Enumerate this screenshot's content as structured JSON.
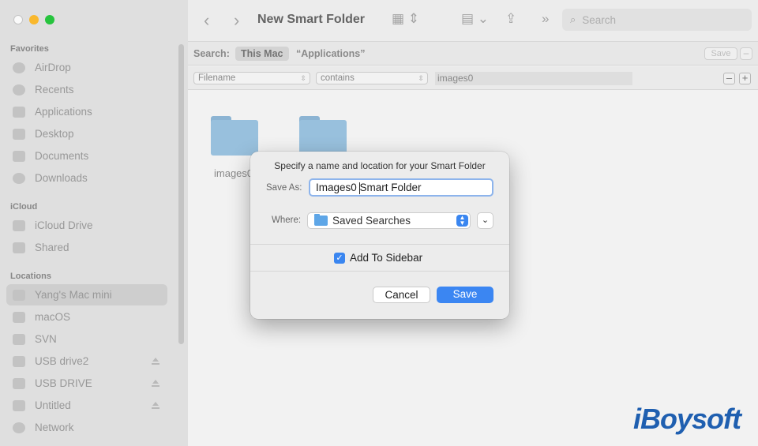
{
  "window": {
    "title": "New Smart Folder"
  },
  "sidebar": {
    "favorites_header": "Favorites",
    "favorites": [
      {
        "label": "AirDrop",
        "icon": "airdrop-icon"
      },
      {
        "label": "Recents",
        "icon": "clock-icon"
      },
      {
        "label": "Applications",
        "icon": "applications-icon"
      },
      {
        "label": "Desktop",
        "icon": "desktop-icon"
      },
      {
        "label": "Documents",
        "icon": "document-icon"
      },
      {
        "label": "Downloads",
        "icon": "download-icon"
      }
    ],
    "icloud_header": "iCloud",
    "icloud": [
      {
        "label": "iCloud Drive",
        "icon": "cloud-icon"
      },
      {
        "label": "Shared",
        "icon": "shared-folder-icon"
      }
    ],
    "locations_header": "Locations",
    "locations": [
      {
        "label": "Yang's Mac mini",
        "icon": "computer-icon",
        "selected": true
      },
      {
        "label": "macOS",
        "icon": "disk-icon"
      },
      {
        "label": "SVN",
        "icon": "disk-icon"
      },
      {
        "label": "USB drive2",
        "icon": "disk-icon",
        "eject": true
      },
      {
        "label": "USB DRIVE",
        "icon": "disk-icon",
        "eject": true
      },
      {
        "label": "Untitled",
        "icon": "disk-icon",
        "eject": true
      },
      {
        "label": "Network",
        "icon": "network-icon"
      }
    ]
  },
  "toolbar": {
    "back": "‹",
    "forward": "›",
    "view_icon": "grid-view-icon",
    "group_icon": "group-icon",
    "share_icon": "share-icon",
    "more": "»",
    "search_placeholder": "Search"
  },
  "scope": {
    "label": "Search:",
    "this_mac": "This Mac",
    "folder": "“Applications”",
    "save": "Save",
    "minus": "–"
  },
  "criteria": {
    "attribute": "Filename",
    "operator": "contains",
    "value": "images0",
    "minus": "–",
    "plus": "+"
  },
  "content": {
    "items": [
      {
        "label": "images0"
      }
    ]
  },
  "dialog": {
    "title": "Specify a name and location for your Smart Folder",
    "save_as_label": "Save As:",
    "save_as_value": "Images0 Smart Folder",
    "where_label": "Where:",
    "where_value": "Saved Searches",
    "add_to_sidebar_label": "Add To Sidebar",
    "add_to_sidebar_checked": true,
    "cancel_label": "Cancel",
    "save_label": "Save"
  },
  "watermark": "iBoysoft",
  "colors": {
    "accent": "#3b86f2",
    "folder": "#9cc4e2",
    "watermark": "#1f5fb0"
  }
}
